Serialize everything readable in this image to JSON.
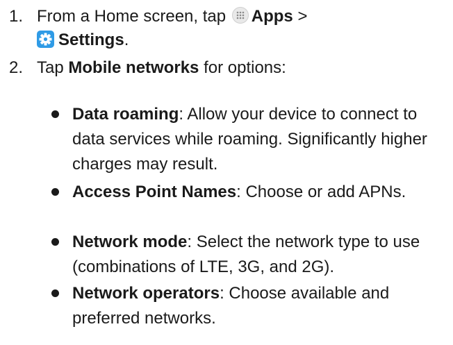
{
  "steps": [
    {
      "number": "1.",
      "prefix": "From a Home screen, tap",
      "apps_label": "Apps",
      "separator": ">",
      "settings_label": "Settings",
      "suffix": "."
    },
    {
      "number": "2.",
      "prefix": "Tap",
      "bold": "Mobile networks",
      "suffix": "for options:"
    }
  ],
  "options": [
    {
      "title": "Data roaming",
      "desc": ": Allow your device to connect to data services while roaming. Significantly higher charges may result."
    },
    {
      "title": "Access Point Names",
      "desc": ": Choose or add APNs."
    },
    {
      "title": "Network mode",
      "desc": ": Select the network type to use (combinations of LTE, 3G, and 2G)."
    },
    {
      "title": "Network operators",
      "desc": ": Choose available and preferred networks."
    }
  ],
  "icons": {
    "apps": "apps-grid-icon",
    "settings": "gear-icon",
    "settings_color": "#2f9be6"
  }
}
